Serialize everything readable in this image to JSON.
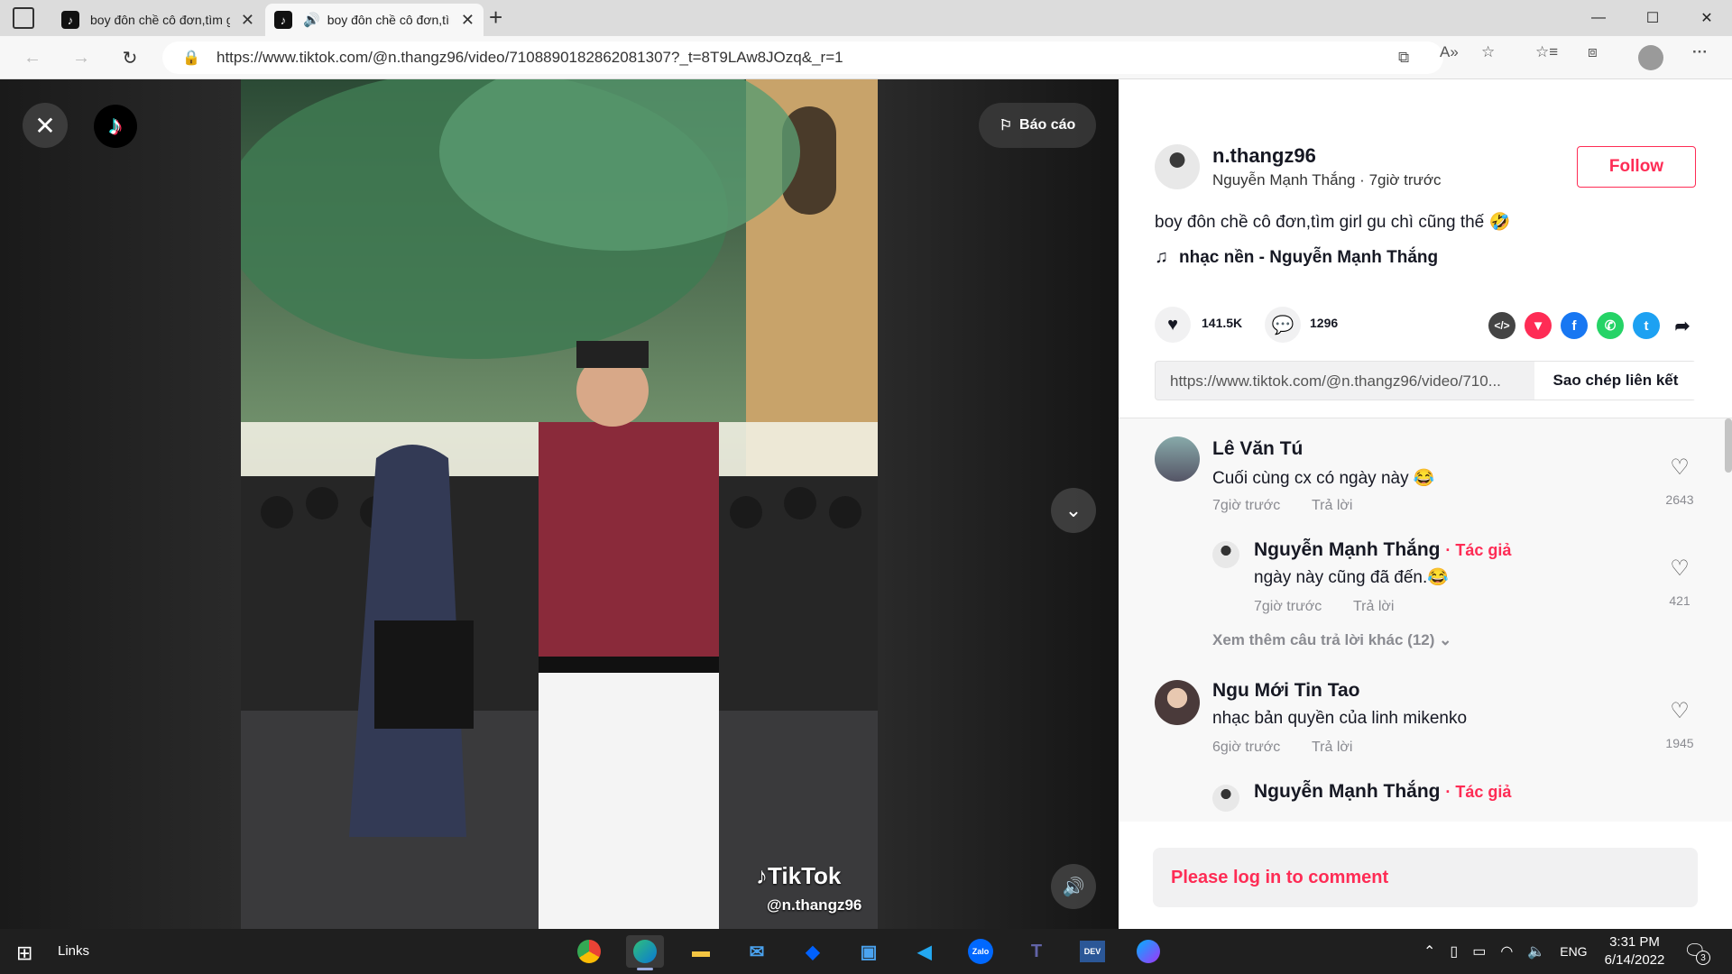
{
  "browser": {
    "tabs": [
      {
        "title": "boy đôn chề cô đơn,tìm girl gu c",
        "active": false
      },
      {
        "title": "boy đôn chề cô đơn,tìm girl",
        "active": true
      }
    ],
    "new_tab": "+",
    "url": "https://www.tiktok.com/@n.thangz96/video/7108890182862081307?_t=8T9LAw8JOzq&_r=1",
    "window_controls": {
      "minimize": "—",
      "maximize": "☐",
      "close": "✕"
    },
    "nav_icons": {
      "back": "←",
      "forward": "→",
      "refresh": "↻",
      "lock": "🔒"
    },
    "toolbar_icons": [
      "open-in-app-icon",
      "read-aloud-icon",
      "add-favorite-icon",
      "favorites-icon",
      "collections-icon",
      "profile-icon",
      "more-icon"
    ]
  },
  "video": {
    "report_label": "Báo cáo",
    "watermark_logo": "TikTok",
    "watermark_user": "@n.thangz96"
  },
  "panel": {
    "username": "n.thangz96",
    "subline": "Nguyễn Mạnh Thắng · 7giờ trước",
    "follow_label": "Follow",
    "description": "boy đôn chề cô đơn,tìm girl gu chì cũng thế 🤣",
    "music": "nhạc nền - Nguyễn Mạnh Thắng",
    "likes": "141.5K",
    "comments_count": "1296",
    "share_link": "https://www.tiktok.com/@n.thangz96/video/710...",
    "copy_label": "Sao chép liên kết",
    "login_prompt": "Please log in to comment"
  },
  "comments": [
    {
      "name": "Lê Văn Tú",
      "text": "Cuối cùng cx có ngày này 😂",
      "time": "7giờ trước",
      "reply": "Trả lời",
      "likes": "2643"
    },
    {
      "name": "Nguyễn Mạnh Thắng",
      "author_tag": "· Tác giả",
      "text": "ngày này cũng đã đến.😂",
      "time": "7giờ trước",
      "reply": "Trả lời",
      "likes": "421"
    },
    {
      "more": "Xem thêm câu trả lời khác (12) ⌄"
    },
    {
      "name": "Ngu Mới Tin Tao",
      "text": "nhạc bản quyền của linh mikenko",
      "time": "6giờ trước",
      "reply": "Trả lời",
      "likes": "1945"
    },
    {
      "name": "Nguyễn Mạnh Thắng",
      "author_tag": "· Tác giả"
    }
  ],
  "taskbar": {
    "links_label": "Links",
    "language": "ENG",
    "time": "3:31 PM",
    "date": "6/14/2022",
    "notification_count": "3",
    "apps": [
      "chrome",
      "edge",
      "file-explorer",
      "mail",
      "dropbox",
      "app",
      "vscode",
      "zalo",
      "teams",
      "devexpress",
      "messenger"
    ]
  },
  "colors": {
    "accent": "#fe2c55",
    "dark": "#161823",
    "taskbar": "#1f1f1f"
  }
}
